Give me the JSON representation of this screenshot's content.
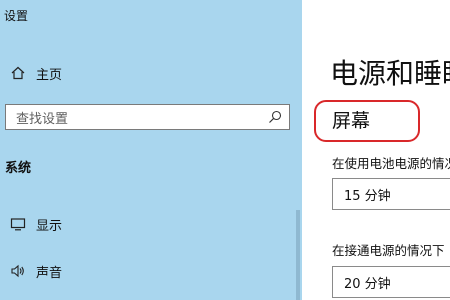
{
  "window": {
    "title": "设置"
  },
  "sidebar": {
    "home": {
      "label": "主页",
      "icon": "home-icon"
    },
    "search": {
      "placeholder": "查找设置",
      "icon": "search-icon"
    },
    "section_header": "系统",
    "items": [
      {
        "label": "显示",
        "icon": "monitor-icon"
      },
      {
        "label": "声音",
        "icon": "speaker-icon"
      }
    ]
  },
  "main": {
    "title": "电源和睡眠",
    "section_title": "屏幕",
    "battery_label": "在使用电池电源的情况下",
    "battery_value": "15 分钟",
    "plugged_label": "在接通电源的情况下",
    "plugged_value": "20 分钟"
  },
  "colors": {
    "sidebar_bg": "#a9d6ee",
    "highlight": "#d9282a"
  }
}
